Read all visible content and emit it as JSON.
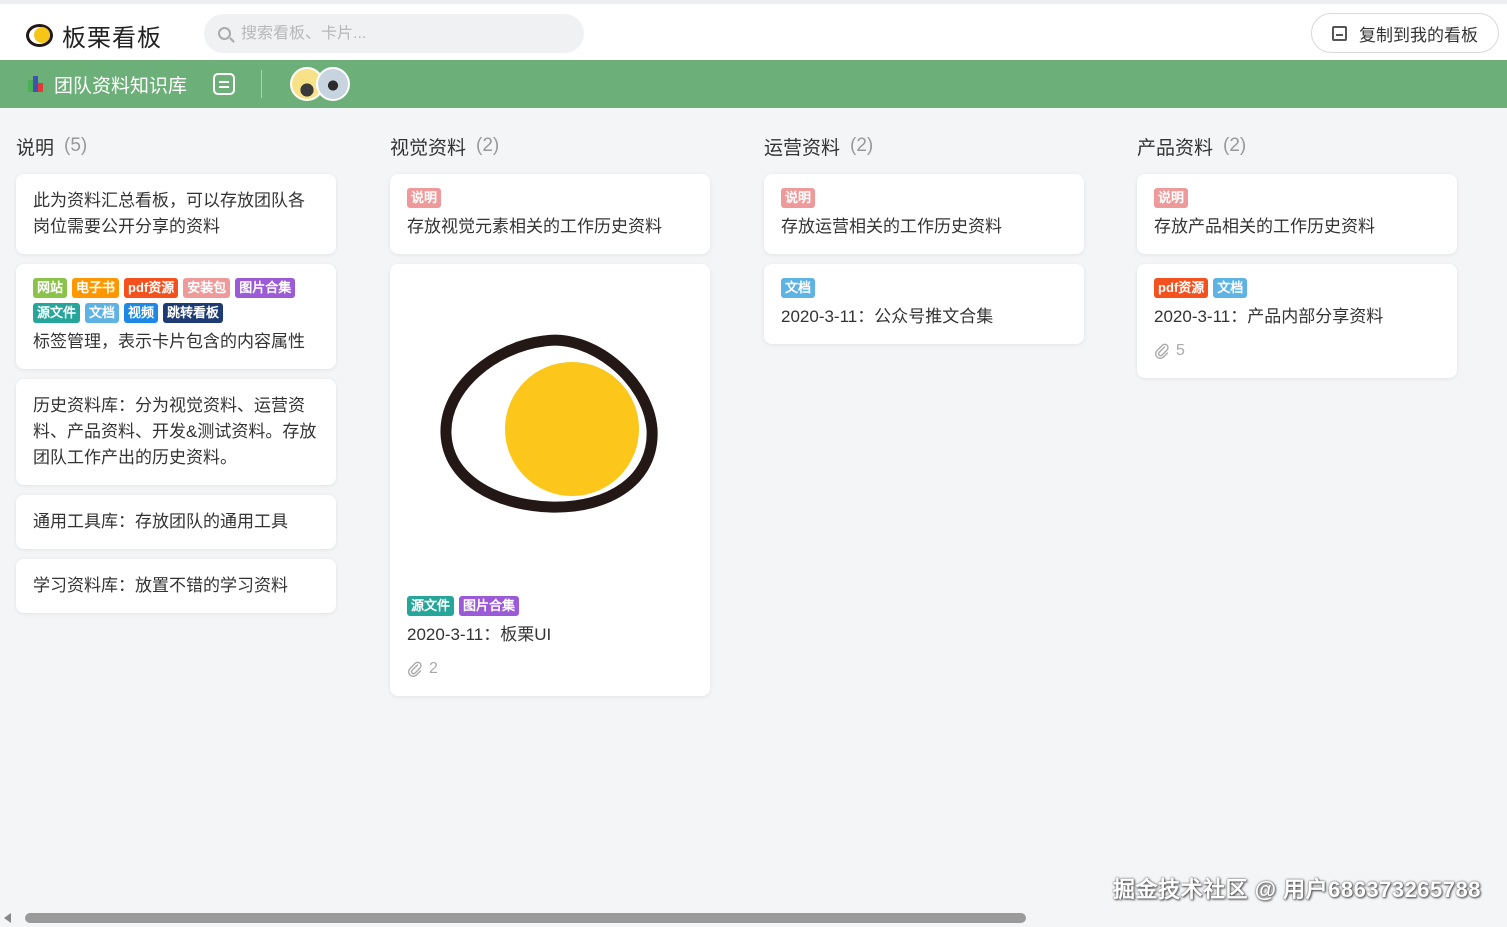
{
  "header": {
    "logo_text": "板栗看板",
    "search_placeholder": "搜索看板、卡片...",
    "copy_button": "复制到我的看板"
  },
  "board": {
    "title": "团队资料知识库",
    "avatars": [
      "member-1",
      "member-2"
    ]
  },
  "colors": {
    "boardbar": "#6caf78",
    "tag_网站": "#8bc34a",
    "tag_电子书": "#ff9800",
    "tag_pdf资源": "#f4511e",
    "tag_安装包": "#ef9a9a",
    "tag_图片合集": "#9c5bd6",
    "tag_源文件": "#26a69a",
    "tag_文档": "#5eb3e4",
    "tag_视频": "#1e88e5",
    "tag_跳转看板": "#1f3b73",
    "tag_说明": "#ef9a9a"
  },
  "columns": [
    {
      "title": "说明",
      "count": "(5)",
      "cards": [
        {
          "text": "此为资料汇总看板，可以存放团队各岗位需要公开分享的资料"
        },
        {
          "tags": [
            "网站",
            "电子书",
            "pdf资源",
            "安装包",
            "图片合集",
            "源文件",
            "文档",
            "视频",
            "跳转看板"
          ],
          "text": "标签管理，表示卡片包含的内容属性"
        },
        {
          "text": "历史资料库：分为视觉资料、运营资料、产品资料、开发&测试资料。存放团队工作产出的历史资料。"
        },
        {
          "text": "通用工具库：存放团队的通用工具"
        },
        {
          "text": "学习资料库：放置不错的学习资料"
        }
      ]
    },
    {
      "title": "视觉资料",
      "count": "(2)",
      "cards": [
        {
          "tags": [
            "说明"
          ],
          "text": "存放视觉元素相关的工作历史资料"
        },
        {
          "cover": "egg-logo-image",
          "tags": [
            "源文件",
            "图片合集"
          ],
          "text": "2020-3-11：板栗UI",
          "attachments": "2"
        }
      ]
    },
    {
      "title": "运营资料",
      "count": "(2)",
      "cards": [
        {
          "tags": [
            "说明"
          ],
          "text": "存放运营相关的工作历史资料"
        },
        {
          "tags": [
            "文档"
          ],
          "text": "2020-3-11：公众号推文合集"
        }
      ]
    },
    {
      "title": "产品资料",
      "count": "(2)",
      "cards": [
        {
          "tags": [
            "说明"
          ],
          "text": "存放产品相关的工作历史资料"
        },
        {
          "tags": [
            "pdf资源",
            "文档"
          ],
          "text": "2020-3-11：产品内部分享资料",
          "attachments": "5"
        }
      ]
    }
  ],
  "watermark": "掘金技术社区 @ 用户686373265788"
}
